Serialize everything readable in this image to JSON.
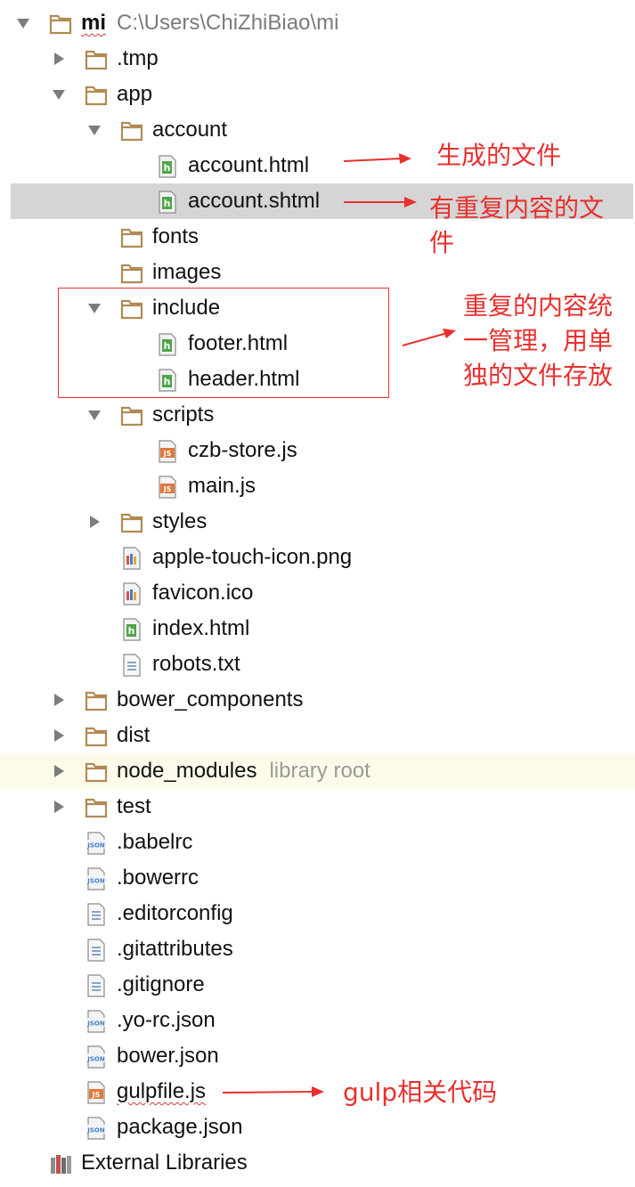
{
  "tree": [
    {
      "label": "mi",
      "path": "C:\\Users\\ChiZhiBiao\\mi",
      "icon": "folder-icon",
      "toggle": "expanded",
      "depth": 0,
      "bold": true,
      "squiggle": true
    },
    {
      "label": ".tmp",
      "icon": "folder-icon",
      "toggle": "collapsed",
      "depth": 1
    },
    {
      "label": "app",
      "icon": "folder-icon",
      "toggle": "expanded",
      "depth": 1
    },
    {
      "label": "account",
      "icon": "folder-icon",
      "toggle": "expanded",
      "depth": 2
    },
    {
      "label": "account.html",
      "icon": "html-file-icon",
      "depth": 3
    },
    {
      "label": "account.shtml",
      "icon": "html-file-icon",
      "depth": 3,
      "selected": true
    },
    {
      "label": "fonts",
      "icon": "folder-icon",
      "depth": 2
    },
    {
      "label": "images",
      "icon": "folder-icon",
      "depth": 2
    },
    {
      "label": "include",
      "icon": "folder-icon",
      "toggle": "expanded",
      "depth": 2
    },
    {
      "label": "footer.html",
      "icon": "html-file-icon",
      "depth": 3
    },
    {
      "label": "header.html",
      "icon": "html-file-icon",
      "depth": 3
    },
    {
      "label": "scripts",
      "icon": "folder-icon",
      "toggle": "expanded",
      "depth": 2
    },
    {
      "label": "czb-store.js",
      "icon": "js-file-icon",
      "depth": 3
    },
    {
      "label": "main.js",
      "icon": "js-file-icon",
      "depth": 3
    },
    {
      "label": "styles",
      "icon": "folder-icon",
      "toggle": "collapsed",
      "depth": 2
    },
    {
      "label": "apple-touch-icon.png",
      "icon": "image-file-icon",
      "depth": 2
    },
    {
      "label": "favicon.ico",
      "icon": "image-file-icon",
      "depth": 2
    },
    {
      "label": "index.html",
      "icon": "html-file-icon",
      "depth": 2
    },
    {
      "label": "robots.txt",
      "icon": "text-file-icon",
      "depth": 2
    },
    {
      "label": "bower_components",
      "icon": "folder-icon",
      "toggle": "collapsed",
      "depth": 1
    },
    {
      "label": "dist",
      "icon": "folder-icon",
      "toggle": "collapsed",
      "depth": 1
    },
    {
      "label": "node_modules",
      "hint": "library root",
      "icon": "folder-icon",
      "toggle": "collapsed",
      "depth": 1,
      "lib_root": true
    },
    {
      "label": "test",
      "icon": "folder-icon",
      "toggle": "collapsed",
      "depth": 1
    },
    {
      "label": ".babelrc",
      "icon": "json-file-icon",
      "depth": 1
    },
    {
      "label": ".bowerrc",
      "icon": "json-file-icon",
      "depth": 1
    },
    {
      "label": ".editorconfig",
      "icon": "text-file-icon",
      "depth": 1
    },
    {
      "label": ".gitattributes",
      "icon": "text-file-icon",
      "depth": 1
    },
    {
      "label": ".gitignore",
      "icon": "text-file-icon",
      "depth": 1
    },
    {
      "label": ".yo-rc.json",
      "icon": "json-file-icon",
      "depth": 1
    },
    {
      "label": "bower.json",
      "icon": "json-file-icon",
      "depth": 1
    },
    {
      "label": "gulpfile.js",
      "icon": "js-file-icon",
      "depth": 1,
      "squiggle": true
    },
    {
      "label": "package.json",
      "icon": "json-file-icon",
      "depth": 1
    },
    {
      "label": "External Libraries",
      "icon": "library-icon",
      "depth": 0
    }
  ],
  "annotations": {
    "generated": "生成的文件",
    "duplicate_line1": "有重复内容的文",
    "duplicate_line2": "件",
    "include_line1": "重复的内容统",
    "include_line2": "一管理，用单",
    "include_line3": "独的文件存放",
    "gulp": "gulp相关代码"
  },
  "colors": {
    "folder": "#b08a52",
    "html_icon": "#4fa54a",
    "js_icon": "#e0793a",
    "json_icon": "#4f7fc0",
    "annotation": "#e8302e",
    "selected_row": "#d5d5d5",
    "library_root_row": "#fcfbe9"
  }
}
